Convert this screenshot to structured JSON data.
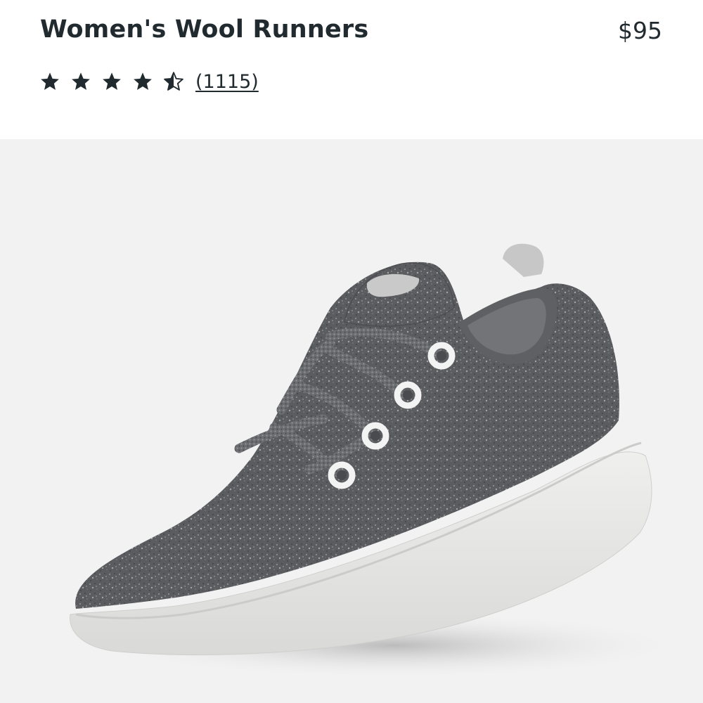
{
  "product": {
    "title": "Women's Wool Runners",
    "price": "$95",
    "rating": {
      "value": 4.5,
      "max": 5,
      "review_count_label": "(1115)"
    }
  },
  "colors": {
    "text": "#212a2f",
    "image_background": "#f2f2f2",
    "wool_gray": "#5a5b5e",
    "sole_white": "#e8e8e6"
  },
  "icons": {
    "full_star": "star-icon",
    "half_star": "half-star-icon"
  }
}
